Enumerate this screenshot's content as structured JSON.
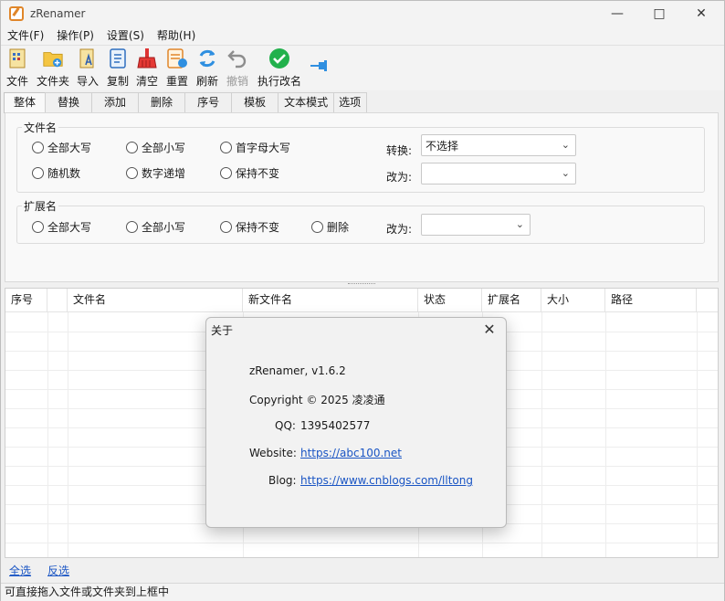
{
  "window": {
    "title": "zRenamer"
  },
  "menu": [
    "文件(F)",
    "操作(P)",
    "设置(S)",
    "帮助(H)"
  ],
  "toolbar": [
    {
      "label": "文件",
      "icon": "file-icon"
    },
    {
      "label": "文件夹",
      "icon": "folder-add-icon"
    },
    {
      "label": "导入",
      "icon": "import-icon"
    },
    {
      "label": "复制",
      "icon": "copy-icon"
    },
    {
      "label": "清空",
      "icon": "broom-icon"
    },
    {
      "label": "重置",
      "icon": "reset-icon"
    },
    {
      "label": "刷新",
      "icon": "refresh-icon"
    },
    {
      "label": "撤销",
      "icon": "undo-icon"
    },
    {
      "label": "执行改名",
      "icon": "execute-check-icon"
    }
  ],
  "tabs": [
    "整体",
    "替换",
    "添加",
    "删除",
    "序号",
    "模板",
    "文本模式",
    "选项"
  ],
  "filename_group": {
    "title": "文件名",
    "options": [
      "全部大写",
      "全部小写",
      "首字母大写",
      "随机数",
      "数字递增",
      "保持不变"
    ],
    "convert_label": "转换:",
    "convert_value": "不选择",
    "change_label": "改为:",
    "change_value": ""
  },
  "ext_group": {
    "title": "扩展名",
    "options": [
      "全部大写",
      "全部小写",
      "保持不变",
      "删除"
    ],
    "change_label": "改为:",
    "change_value": ""
  },
  "table": {
    "columns": [
      "序号",
      "",
      "文件名",
      "新文件名",
      "状态",
      "扩展名",
      "大小",
      "路径"
    ]
  },
  "links": {
    "select_all": "全选",
    "invert": "反选"
  },
  "status": "可直接拖入文件或文件夹到上框中",
  "about": {
    "title": "关于",
    "version": "zRenamer, v1.6.2",
    "copyright": "Copyright © 2025 凌凌通",
    "qq_label": "QQ:",
    "qq": "1395402577",
    "website_label": "Website:",
    "website": "https://abc100.net",
    "blog_label": "Blog:",
    "blog": "https://www.cnblogs.com/lltong"
  },
  "colors": {
    "accent": "#1a55c4",
    "check": "#22b14c",
    "refresh": "#2f8fe0"
  }
}
